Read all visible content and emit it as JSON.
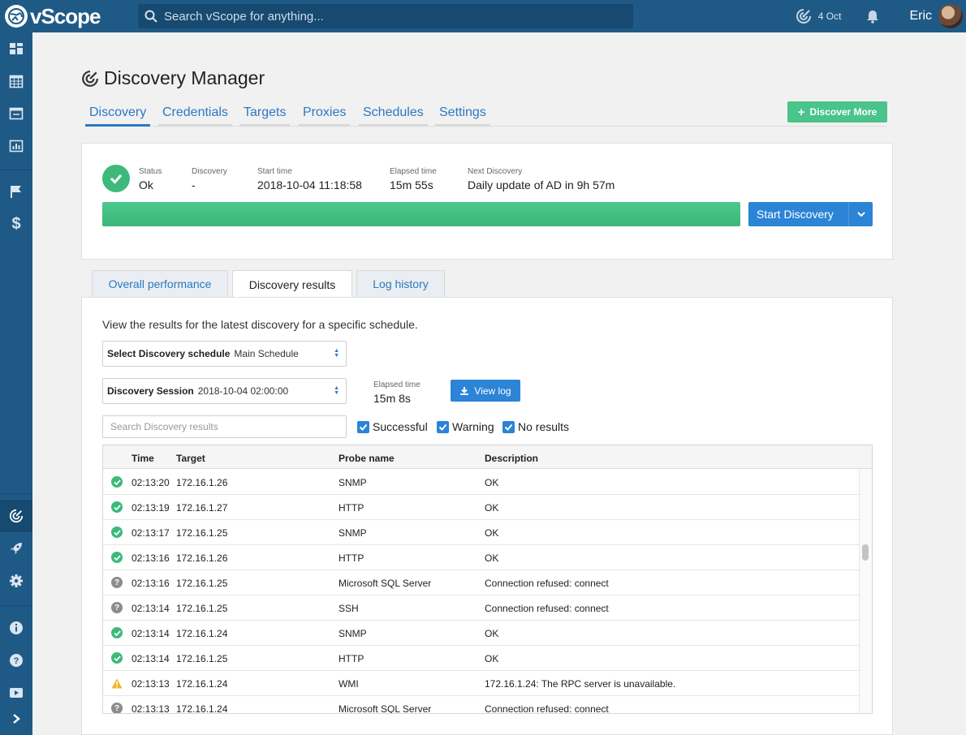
{
  "app": {
    "name": "vScope"
  },
  "search": {
    "placeholder": "Search vScope for anything..."
  },
  "topbar": {
    "date": "4 Oct",
    "user": "Eric"
  },
  "page": {
    "title": "Discovery Manager",
    "tabs": [
      "Discovery",
      "Credentials",
      "Targets",
      "Proxies",
      "Schedules",
      "Settings"
    ],
    "active_tab": "Discovery",
    "discover_more_label": "Discover More"
  },
  "status": {
    "status_label": "Status",
    "status_value": "Ok",
    "discovery_label": "Discovery",
    "discovery_value": "-",
    "start_label": "Start time",
    "start_value": "2018-10-04 11:18:58",
    "elapsed_label": "Elapsed time",
    "elapsed_value": "15m 55s",
    "next_label": "Next Discovery",
    "next_value": "Daily update of AD in 9h 57m",
    "progress": 1.0,
    "start_button": "Start Discovery"
  },
  "result_tabs": [
    "Overall performance",
    "Discovery results",
    "Log history"
  ],
  "active_result_tab": "Discovery results",
  "results": {
    "intro": "View the results for the latest discovery for a specific schedule.",
    "schedule_label": "Select Discovery schedule",
    "schedule_value": "Main Schedule",
    "session_label": "Discovery Session",
    "session_value": "2018-10-04 02:00:00",
    "elapsed_label": "Elapsed time",
    "elapsed_value": "15m 8s",
    "view_log": "View log",
    "search_placeholder": "Search Discovery results",
    "filters": [
      "Successful",
      "Warning",
      "No results"
    ],
    "columns": [
      "Time",
      "Target",
      "Probe name",
      "Description"
    ],
    "rows": [
      {
        "status": "ok",
        "time": "02:13:20",
        "target": "172.16.1.26",
        "probe": "SNMP",
        "desc": "OK"
      },
      {
        "status": "ok",
        "time": "02:13:19",
        "target": "172.16.1.27",
        "probe": "HTTP",
        "desc": "OK"
      },
      {
        "status": "ok",
        "time": "02:13:17",
        "target": "172.16.1.25",
        "probe": "SNMP",
        "desc": "OK"
      },
      {
        "status": "ok",
        "time": "02:13:16",
        "target": "172.16.1.26",
        "probe": "HTTP",
        "desc": "OK"
      },
      {
        "status": "unknown",
        "time": "02:13:16",
        "target": "172.16.1.25",
        "probe": "Microsoft SQL Server",
        "desc": "Connection refused: connect"
      },
      {
        "status": "unknown",
        "time": "02:13:14",
        "target": "172.16.1.25",
        "probe": "SSH",
        "desc": "Connection refused: connect"
      },
      {
        "status": "ok",
        "time": "02:13:14",
        "target": "172.16.1.24",
        "probe": "SNMP",
        "desc": "OK"
      },
      {
        "status": "ok",
        "time": "02:13:14",
        "target": "172.16.1.25",
        "probe": "HTTP",
        "desc": "OK"
      },
      {
        "status": "warning",
        "time": "02:13:13",
        "target": "172.16.1.24",
        "probe": "WMI",
        "desc": "172.16.1.24: The RPC server is unavailable."
      },
      {
        "status": "unknown",
        "time": "02:13:13",
        "target": "172.16.1.24",
        "probe": "Microsoft SQL Server",
        "desc": "Connection refused: connect"
      }
    ]
  },
  "colors": {
    "brand": "#1f5a86",
    "accent": "#2b84d6",
    "success": "#3dba7a",
    "warning": "#f0b429"
  },
  "sidebar_icons": [
    "dashboard-icon",
    "calendar-icon",
    "window-icon",
    "chart-icon",
    "flag-icon",
    "dollar-icon",
    "discovery-icon",
    "rocket-icon",
    "gear-icon",
    "info-icon",
    "help-icon",
    "video-icon",
    "chevron-right-icon"
  ]
}
